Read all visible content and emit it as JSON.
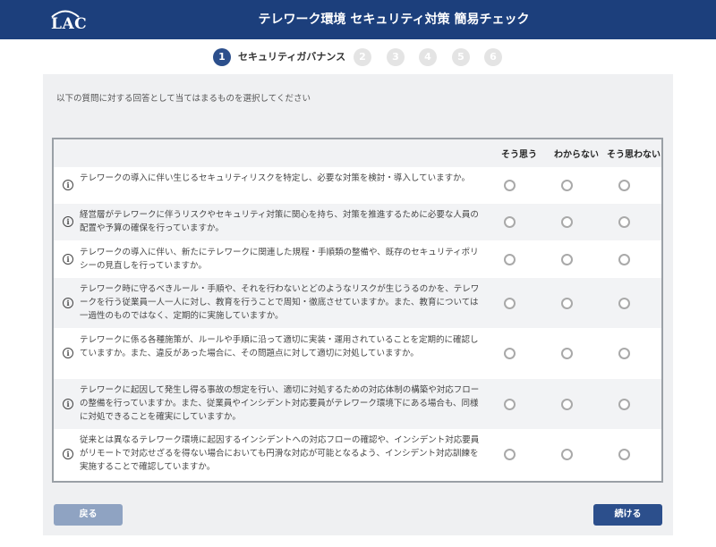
{
  "header": {
    "logo_text": "LAC",
    "title": "テレワーク環境 セキュリティ対策 簡易チェック"
  },
  "colors": {
    "header_bg": "#1c3f7c",
    "accent": "#2c4f8c",
    "back_button": "#8fa3c2",
    "panel_bg": "#eff0f2"
  },
  "steps": {
    "items": [
      "1",
      "2",
      "3",
      "4",
      "5",
      "6"
    ],
    "active_label": "セキュリティガバナンス"
  },
  "instruction": "以下の質問に対する回答として当てはまるものを選択してください",
  "table": {
    "columns": [
      "そう思う",
      "わからない",
      "そう思わない"
    ],
    "questions": [
      {
        "text": "テレワークの導入に伴い生じるセキュリティリスクを特定し、必要な対策を検討・導入していますか。",
        "info_icon": "info-icon"
      },
      {
        "text": "経営層がテレワークに伴うリスクやセキュリティ対策に関心を持ち、対策を推進するために必要な人員の配置や予算の確保を行っていますか。",
        "info_icon": "info-icon"
      },
      {
        "text": "テレワークの導入に伴い、新たにテレワークに関連した規程・手順類の整備や、既存のセキュリティポリシーの見直しを行っていますか。",
        "info_icon": "info-icon"
      },
      {
        "text": "テレワーク時に守るべきルール・手順や、それを行わないとどのようなリスクが生じうるのかを、テレワークを行う従業員一人一人に対し、教育を行うことで周知・徹底させていますか。また、教育については一過性のものではなく、定期的に実施していますか。",
        "info_icon": "info-icon"
      },
      {
        "text": "テレワークに係る各種施策が、ルールや手順に沿って適切に実装・運用されていることを定期的に確認していますか。また、違反があった場合に、その問題点に対して適切に対処していますか。",
        "info_icon": "info-icon"
      },
      {
        "text": "テレワークに起因して発生し得る事故の想定を行い、適切に対処するための対応体制の構築や対応フローの整備を行っていますか。また、従業員やインシデント対応要員がテレワーク環境下にある場合も、同様に対処できることを確実にしていますか。",
        "info_icon": "info-icon"
      },
      {
        "text": "従来とは異なるテレワーク環境に起因するインシデントへの対応フローの確認や、インシデント対応要員がリモートで対応せざるを得ない場合においても円滑な対応が可能となるよう、インシデント対応訓練を実施することで確認していますか。",
        "info_icon": "info-icon"
      }
    ]
  },
  "buttons": {
    "back": "戻る",
    "next": "続ける"
  }
}
